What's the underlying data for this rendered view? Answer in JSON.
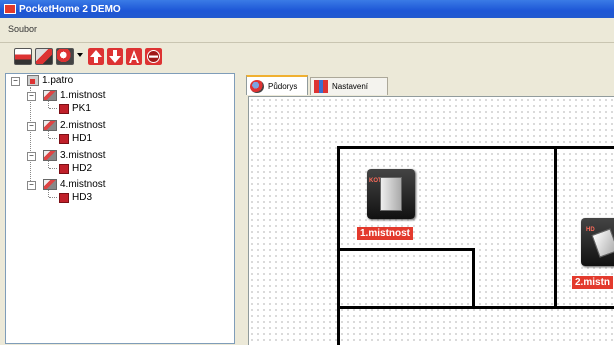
{
  "window": {
    "title": "PocketHome 2 DEMO"
  },
  "menu": {
    "items": [
      "Soubor"
    ]
  },
  "toolbar": {
    "buttons": [
      "open-file-icon",
      "save-file-icon",
      "network-icon",
      "arrow-up-icon",
      "arrow-down-icon",
      "font-icon",
      "stop-icon"
    ]
  },
  "tree": {
    "root": "1.patro",
    "rooms": [
      {
        "label": "1.mistnost",
        "device": "PK1"
      },
      {
        "label": "2.mistnost",
        "device": "HD1"
      },
      {
        "label": "3.mistnost",
        "device": "HD2"
      },
      {
        "label": "4.mistnost",
        "device": "HD3"
      }
    ]
  },
  "tabs": [
    {
      "label": "Půdorys",
      "active": true
    },
    {
      "label": "Nastavení",
      "active": false
    }
  ],
  "floorplan": {
    "rooms": [
      {
        "label": "1.mistnost",
        "device_badge": "KOTEL"
      },
      {
        "label": "2.mistn",
        "device_badge": "HD"
      }
    ]
  },
  "colors": {
    "accent": "#e33a2d",
    "titlebar": "#1d56d6",
    "window_bg": "#ece9d8"
  }
}
